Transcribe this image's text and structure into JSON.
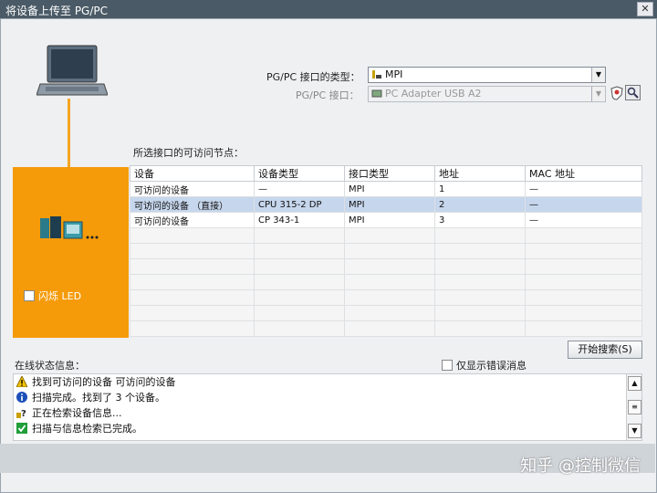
{
  "window": {
    "title": "将设备上传至 PG/PC",
    "close": "✕"
  },
  "interface": {
    "type_label": "PG/PC 接口的类型：",
    "type_value": "MPI",
    "port_label": "PG/PC 接口：",
    "port_value": "PC Adapter USB A2"
  },
  "nodes": {
    "title": "所选接口的可访问节点：",
    "columns": [
      "设备",
      "设备类型",
      "接口类型",
      "地址",
      "MAC 地址"
    ],
    "rows": [
      [
        "可访问的设备",
        "—",
        "MPI",
        "1",
        "—"
      ],
      [
        "可访问的设备 （直接）",
        "CPU 315-2 DP",
        "MPI",
        "2",
        "—"
      ],
      [
        "可访问的设备",
        "CP 343-1",
        "MPI",
        "3",
        "—"
      ]
    ]
  },
  "flash_led": "闪烁 LED",
  "start_search": "开始搜索(S)",
  "status": {
    "title": "在线状态信息：",
    "errors_only": "仅显示错误消息",
    "messages": [
      {
        "icon": "warning-icon",
        "text": "找到可访问的设备 可访问的设备"
      },
      {
        "icon": "info-icon",
        "text": "扫描完成。找到了 3 个设备。"
      },
      {
        "icon": "search-question-icon",
        "text": "正在检索设备信息..."
      },
      {
        "icon": "check-icon",
        "text": "扫描与信息检索已完成。"
      }
    ]
  },
  "watermark": "知乎 @控制微信"
}
